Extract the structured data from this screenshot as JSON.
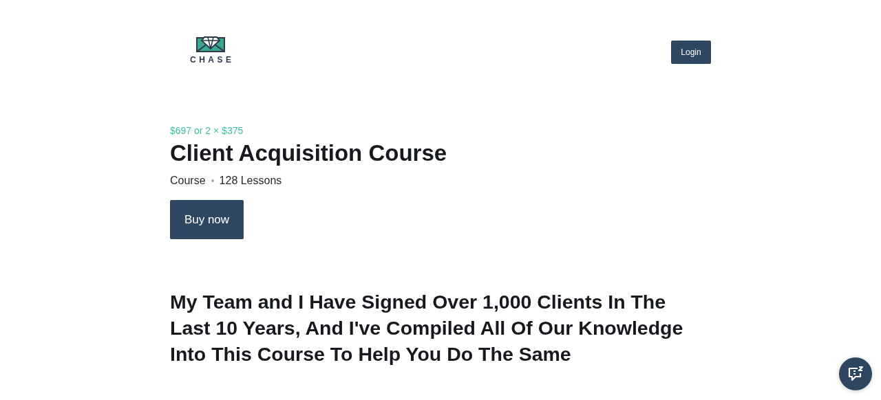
{
  "header": {
    "logo_text": "CHASE",
    "login": "Login"
  },
  "product": {
    "price": "$697 or 2 × $375",
    "title": "Client Acquisition Course",
    "type": "Course",
    "lessons": "128 Lessons",
    "buy": "Buy now"
  },
  "headline": "My Team and I Have Signed Over 1,000 Clients In The Last 10 Years, And I've Compiled All Of Our Knowledge Into This Course To Help You Do The Same"
}
